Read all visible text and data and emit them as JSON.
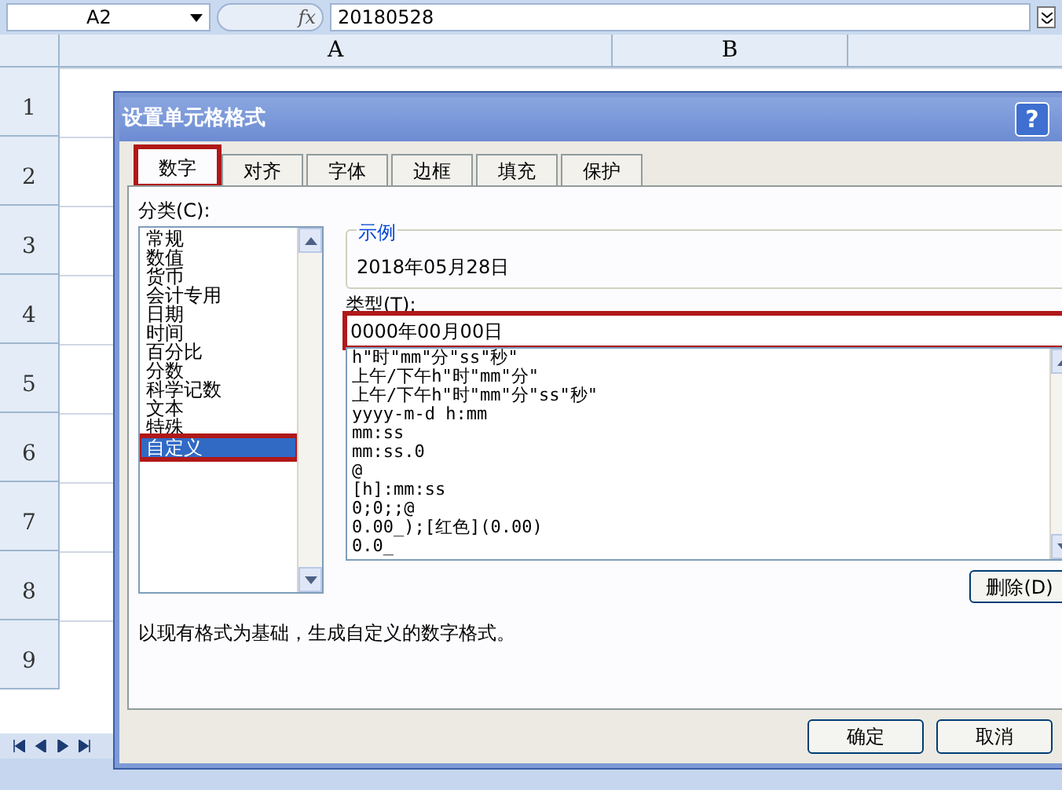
{
  "formula_bar": {
    "name_box": "A2",
    "fx": "fx",
    "value": "20180528"
  },
  "columns": [
    {
      "label": "A"
    },
    {
      "label": "B"
    }
  ],
  "rows": [
    "1",
    "2",
    "3",
    "4",
    "5",
    "6",
    "7",
    "8",
    "9"
  ],
  "dialog": {
    "title": "设置单元格格式",
    "help": "?",
    "tabs": [
      {
        "label": "数字",
        "selected": true,
        "highlighted": true
      },
      {
        "label": "对齐",
        "selected": false,
        "highlighted": false
      },
      {
        "label": "字体",
        "selected": false,
        "highlighted": false
      },
      {
        "label": "边框",
        "selected": false,
        "highlighted": false
      },
      {
        "label": "填充",
        "selected": false,
        "highlighted": false
      },
      {
        "label": "保护",
        "selected": false,
        "highlighted": false
      }
    ],
    "category_label": "分类(C):",
    "categories": [
      {
        "label": "常规",
        "selected": false,
        "highlighted": false
      },
      {
        "label": "数值",
        "selected": false,
        "highlighted": false
      },
      {
        "label": "货币",
        "selected": false,
        "highlighted": false
      },
      {
        "label": "会计专用",
        "selected": false,
        "highlighted": false
      },
      {
        "label": "日期",
        "selected": false,
        "highlighted": false
      },
      {
        "label": "时间",
        "selected": false,
        "highlighted": false
      },
      {
        "label": "百分比",
        "selected": false,
        "highlighted": false
      },
      {
        "label": "分数",
        "selected": false,
        "highlighted": false
      },
      {
        "label": "科学记数",
        "selected": false,
        "highlighted": false
      },
      {
        "label": "文本",
        "selected": false,
        "highlighted": false
      },
      {
        "label": "特殊",
        "selected": false,
        "highlighted": false
      },
      {
        "label": "自定义",
        "selected": true,
        "highlighted": true
      }
    ],
    "sample": {
      "legend": "示例",
      "value": "2018年05月28日"
    },
    "type_label": "类型(T):",
    "type_field": {
      "value": "0000年00月00日",
      "highlighted": true
    },
    "formats": [
      "h\"时\"mm\"分\"ss\"秒\"",
      "上午/下午h\"时\"mm\"分\"",
      "上午/下午h\"时\"mm\"分\"ss\"秒\"",
      "yyyy-m-d h:mm",
      "mm:ss",
      "mm:ss.0",
      "@",
      "[h]:mm:ss",
      "0;0;;@",
      "0.00_);[红色](0.00)",
      "0.0_"
    ],
    "delete_button": "删除(D)",
    "description": "以现有格式为基础，生成自定义的数字格式。",
    "buttons": [
      "确定",
      "取消"
    ]
  }
}
